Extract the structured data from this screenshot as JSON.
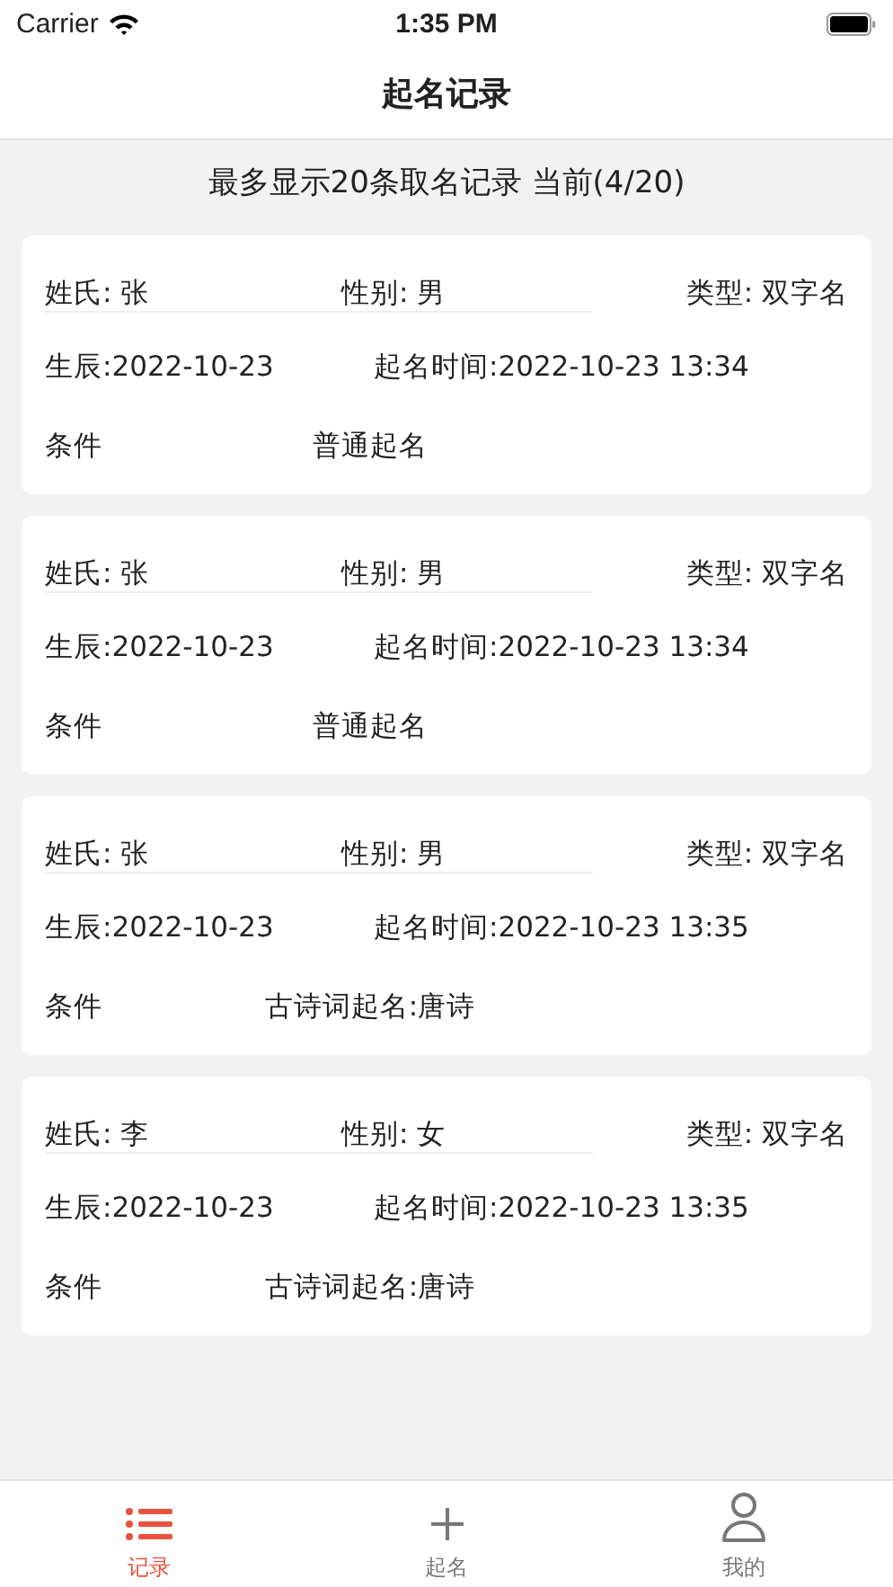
{
  "status_bar": {
    "carrier": "Carrier",
    "time": "1:35 PM"
  },
  "nav": {
    "title": "起名记录"
  },
  "summary": "最多显示20条取名记录 当前(4/20)",
  "records": [
    {
      "surname": "姓氏: 张",
      "gender": "性别: 男",
      "type": "类型: 双字名",
      "birth": "生辰:2022-10-23",
      "named_at": "起名时间:2022-10-23 13:34",
      "condition_label": "条件",
      "condition": "普通起名"
    },
    {
      "surname": "姓氏: 张",
      "gender": "性别: 男",
      "type": "类型: 双字名",
      "birth": "生辰:2022-10-23",
      "named_at": "起名时间:2022-10-23 13:34",
      "condition_label": "条件",
      "condition": "普通起名"
    },
    {
      "surname": "姓氏: 张",
      "gender": "性别: 男",
      "type": "类型: 双字名",
      "birth": "生辰:2022-10-23",
      "named_at": "起名时间:2022-10-23 13:35",
      "condition_label": "条件",
      "condition": "古诗词起名:唐诗"
    },
    {
      "surname": "姓氏: 李",
      "gender": "性别: 女",
      "type": "类型: 双字名",
      "birth": "生辰:2022-10-23",
      "named_at": "起名时间:2022-10-23 13:35",
      "condition_label": "条件",
      "condition": "古诗词起名:唐诗"
    }
  ],
  "tabs": [
    {
      "kind": "list",
      "label": "记录",
      "selected": true
    },
    {
      "kind": "plus",
      "label": "起名",
      "selected": false
    },
    {
      "kind": "person",
      "label": "我的",
      "selected": false
    }
  ]
}
